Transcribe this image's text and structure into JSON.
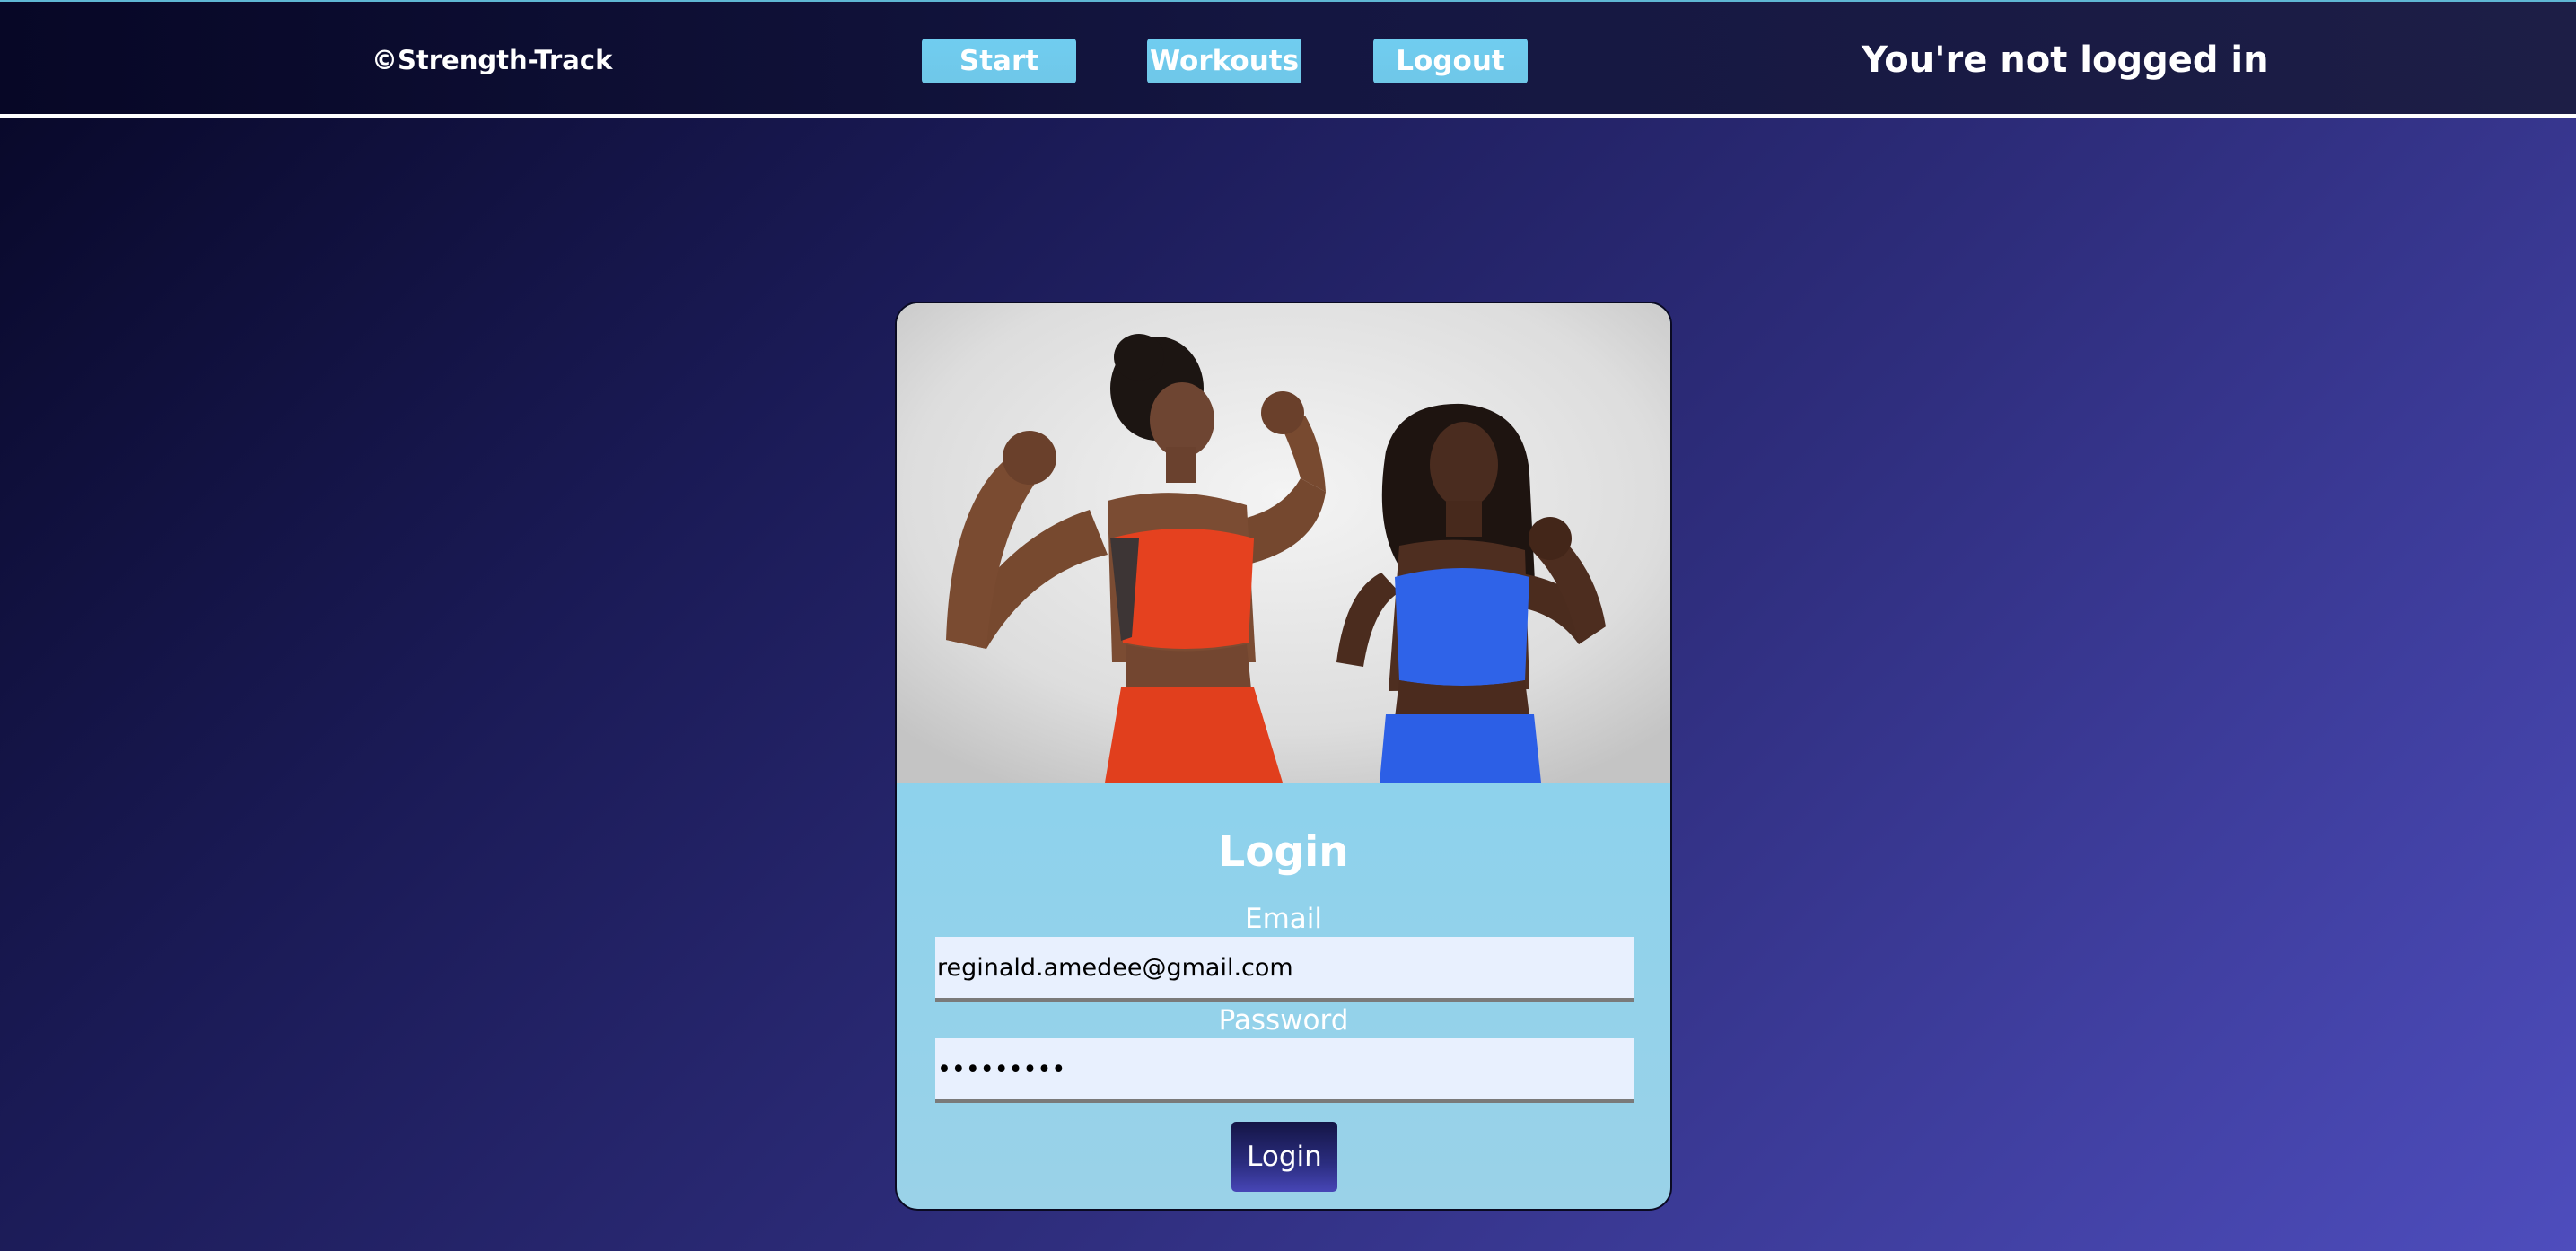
{
  "navbar": {
    "brand": "©Strength-Track",
    "start_label": "Start",
    "workouts_label": "Workouts",
    "logout_label": "Logout",
    "status_text": "You're not logged in"
  },
  "login_form": {
    "title": "Login",
    "email_label": "Email",
    "email_value": "reginald.amedee@gmail.com",
    "password_label": "Password",
    "password_value": "•••••••••",
    "submit_label": "Login"
  },
  "colors": {
    "accent": "#6fc7e8",
    "card_background": "#7fd1f1",
    "input_background": "#e8f0fe",
    "woman_left_outfit": "#e5411f",
    "woman_right_outfit": "#2f63e8"
  }
}
